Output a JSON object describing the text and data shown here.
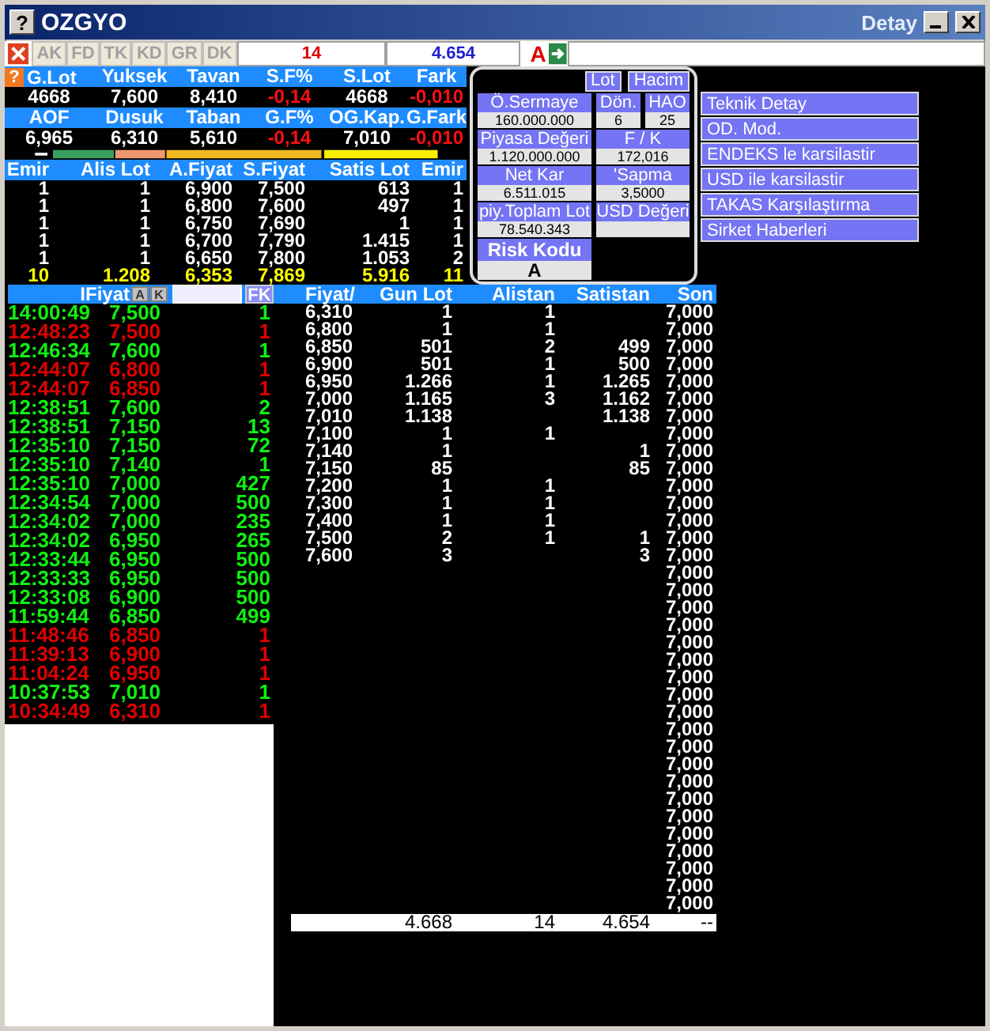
{
  "window": {
    "help": "?",
    "title": "OZGYO",
    "detail_title": "Detay"
  },
  "toolbar": {
    "tabs": [
      "AK",
      "FD",
      "TK",
      "KD",
      "GR",
      "DK"
    ],
    "count": "14",
    "value": "4.654",
    "flag": "A"
  },
  "summary": {
    "help": "?",
    "rows": [
      {
        "headers": [
          "G.Lot",
          "Yuksek",
          "Tavan",
          "S.F%",
          "S.Lot",
          "Fark"
        ],
        "values": [
          {
            "text": "4668",
            "negative": false
          },
          {
            "text": "7,600",
            "negative": false
          },
          {
            "text": "8,410",
            "negative": false
          },
          {
            "text": "-0,14",
            "negative": true
          },
          {
            "text": "4668",
            "negative": false
          },
          {
            "text": "-0,010",
            "negative": true
          }
        ]
      },
      {
        "headers": [
          "AOF",
          "Dusuk",
          "Taban",
          "G.F%",
          "OG.Kap.",
          "G.Fark"
        ],
        "values": [
          {
            "text": "6,965",
            "negative": false
          },
          {
            "text": "6,310",
            "negative": false
          },
          {
            "text": "5,610",
            "negative": false
          },
          {
            "text": "-0,14",
            "negative": true
          },
          {
            "text": "7,010",
            "negative": false
          },
          {
            "text": "-0,010",
            "negative": true
          }
        ]
      }
    ]
  },
  "depth": {
    "columns": [
      "Emir",
      "Alis Lot",
      "A.Fiyat",
      "S.Fiyat",
      "Satis Lot",
      "Emir"
    ],
    "rows": [
      [
        "1",
        "1",
        "6,900",
        "7,500",
        "613",
        "1"
      ],
      [
        "1",
        "1",
        "6,800",
        "7,600",
        "497",
        "1"
      ],
      [
        "1",
        "1",
        "6,750",
        "7,690",
        "1",
        "1"
      ],
      [
        "1",
        "1",
        "6,700",
        "7,790",
        "1.415",
        "1"
      ],
      [
        "1",
        "1",
        "6,650",
        "7,800",
        "1.053",
        "2"
      ]
    ],
    "total": [
      "10",
      "1.208",
      "6,353",
      "7,869",
      "5.916",
      "11"
    ]
  },
  "panel": {
    "buttons": [
      "Lot",
      "Hacim"
    ],
    "rows": [
      [
        {
          "label": "Ö.Sermaye",
          "value": "160.000.000"
        },
        {
          "label": "Dön.",
          "value": "6"
        },
        {
          "label": "HAO",
          "value": "25"
        }
      ],
      [
        {
          "label": "Piyasa Değeri",
          "value": "1.120.000.000"
        },
        {
          "label": "F / K",
          "value": "172,016"
        }
      ],
      [
        {
          "label": "Net Kar",
          "value": "6.511.015"
        },
        {
          "label": "'Sapma",
          "value": "3,5000"
        }
      ],
      [
        {
          "label": "piy.Toplam Lot",
          "value": "78.540.343"
        },
        {
          "label": "USD Değeri"
        }
      ]
    ],
    "risk": {
      "label": "Risk Kodu",
      "value": "A"
    }
  },
  "menu": [
    "Teknik Detay",
    "OD. Mod.",
    "ENDEKS le karsilastir",
    "USD ile karsilastir",
    "TAKAS Karşılaştırma",
    "Sirket Haberleri"
  ],
  "trades": {
    "header": "IFiyat",
    "buttons": [
      "A",
      "K"
    ],
    "fk": "FK",
    "rows": [
      {
        "time": "14:00:49",
        "price": "7,500",
        "lot": "1",
        "color": "#10f010"
      },
      {
        "time": "12:48:23",
        "price": "7,500",
        "lot": "1",
        "color": "#e00000"
      },
      {
        "time": "12:46:34",
        "price": "7,600",
        "lot": "1",
        "color": "#10f010"
      },
      {
        "time": "12:44:07",
        "price": "6,800",
        "lot": "1",
        "color": "#e00000"
      },
      {
        "time": "12:44:07",
        "price": "6,850",
        "lot": "1",
        "color": "#e00000"
      },
      {
        "time": "12:38:51",
        "price": "7,600",
        "lot": "2",
        "color": "#10f010"
      },
      {
        "time": "12:38:51",
        "price": "7,150",
        "lot": "13",
        "color": "#10f010"
      },
      {
        "time": "12:35:10",
        "price": "7,150",
        "lot": "72",
        "color": "#10f010"
      },
      {
        "time": "12:35:10",
        "price": "7,140",
        "lot": "1",
        "color": "#10f010"
      },
      {
        "time": "12:35:10",
        "price": "7,000",
        "lot": "427",
        "color": "#10f010"
      },
      {
        "time": "12:34:54",
        "price": "7,000",
        "lot": "500",
        "color": "#10f010"
      },
      {
        "time": "12:34:02",
        "price": "7,000",
        "lot": "235",
        "color": "#10f010"
      },
      {
        "time": "12:34:02",
        "price": "6,950",
        "lot": "265",
        "color": "#10f010"
      },
      {
        "time": "12:33:44",
        "price": "6,950",
        "lot": "500",
        "color": "#10f010"
      },
      {
        "time": "12:33:33",
        "price": "6,950",
        "lot": "500",
        "color": "#10f010"
      },
      {
        "time": "12:33:08",
        "price": "6,900",
        "lot": "500",
        "color": "#10f010"
      },
      {
        "time": "11:59:44",
        "price": "6,850",
        "lot": "499",
        "color": "#10f010"
      },
      {
        "time": "11:48:46",
        "price": "6,850",
        "lot": "1",
        "color": "#e00000"
      },
      {
        "time": "11:39:13",
        "price": "6,900",
        "lot": "1",
        "color": "#e00000"
      },
      {
        "time": "11:04:24",
        "price": "6,950",
        "lot": "1",
        "color": "#e00000"
      },
      {
        "time": "10:37:53",
        "price": "7,010",
        "lot": "1",
        "color": "#10f010"
      },
      {
        "time": "10:34:49",
        "price": "6,310",
        "lot": "1",
        "color": "#e00000"
      }
    ]
  },
  "levels": {
    "columns": [
      "Fiyat/",
      "Gun Lot",
      "Alistan",
      "Satistan",
      "Son"
    ],
    "rows": [
      {
        "price": "6,310",
        "lot": "1",
        "buy": "1",
        "last": "7,000"
      },
      {
        "price": "6,800",
        "lot": "1",
        "buy": "1",
        "last": "7,000"
      },
      {
        "price": "6,850",
        "lot": "501",
        "buy": "2",
        "sell": "499",
        "last": "7,000"
      },
      {
        "price": "6,900",
        "lot": "501",
        "buy": "1",
        "sell": "500",
        "last": "7,000"
      },
      {
        "price": "6,950",
        "lot": "1.266",
        "buy": "1",
        "sell": "1.265",
        "last": "7,000"
      },
      {
        "price": "7,000",
        "lot": "1.165",
        "buy": "3",
        "sell": "1.162",
        "last": "7,000"
      },
      {
        "price": "7,010",
        "lot": "1.138",
        "sell": "1.138",
        "last": "7,000"
      },
      {
        "price": "7,100",
        "lot": "1",
        "buy": "1",
        "last": "7,000"
      },
      {
        "price": "7,140",
        "lot": "1",
        "sell": "1",
        "last": "7,000"
      },
      {
        "price": "7,150",
        "lot": "85",
        "sell": "85",
        "last": "7,000"
      },
      {
        "price": "7,200",
        "lot": "1",
        "buy": "1",
        "last": "7,000"
      },
      {
        "price": "7,300",
        "lot": "1",
        "buy": "1",
        "last": "7,000"
      },
      {
        "price": "7,400",
        "lot": "1",
        "buy": "1",
        "last": "7,000"
      },
      {
        "price": "7,500",
        "lot": "2",
        "buy": "1",
        "sell": "1",
        "last": "7,000"
      },
      {
        "price": "7,600",
        "lot": "3",
        "sell": "3",
        "last": "7,000"
      },
      {
        "last": "7,000"
      },
      {
        "last": "7,000"
      },
      {
        "last": "7,000"
      },
      {
        "last": "7,000"
      },
      {
        "last": "7,000"
      },
      {
        "last": "7,000"
      },
      {
        "last": "7,000"
      },
      {
        "last": "7,000"
      },
      {
        "last": "7,000"
      },
      {
        "last": "7,000"
      },
      {
        "last": "7,000"
      },
      {
        "last": "7,000"
      },
      {
        "last": "7,000"
      },
      {
        "last": "7,000"
      },
      {
        "last": "7,000"
      },
      {
        "last": "7,000"
      },
      {
        "last": "7,000"
      },
      {
        "last": "7,000"
      },
      {
        "last": "7,000"
      },
      {
        "last": "7,000"
      }
    ],
    "total": [
      "4.668",
      "14",
      "4.654",
      "--"
    ]
  }
}
